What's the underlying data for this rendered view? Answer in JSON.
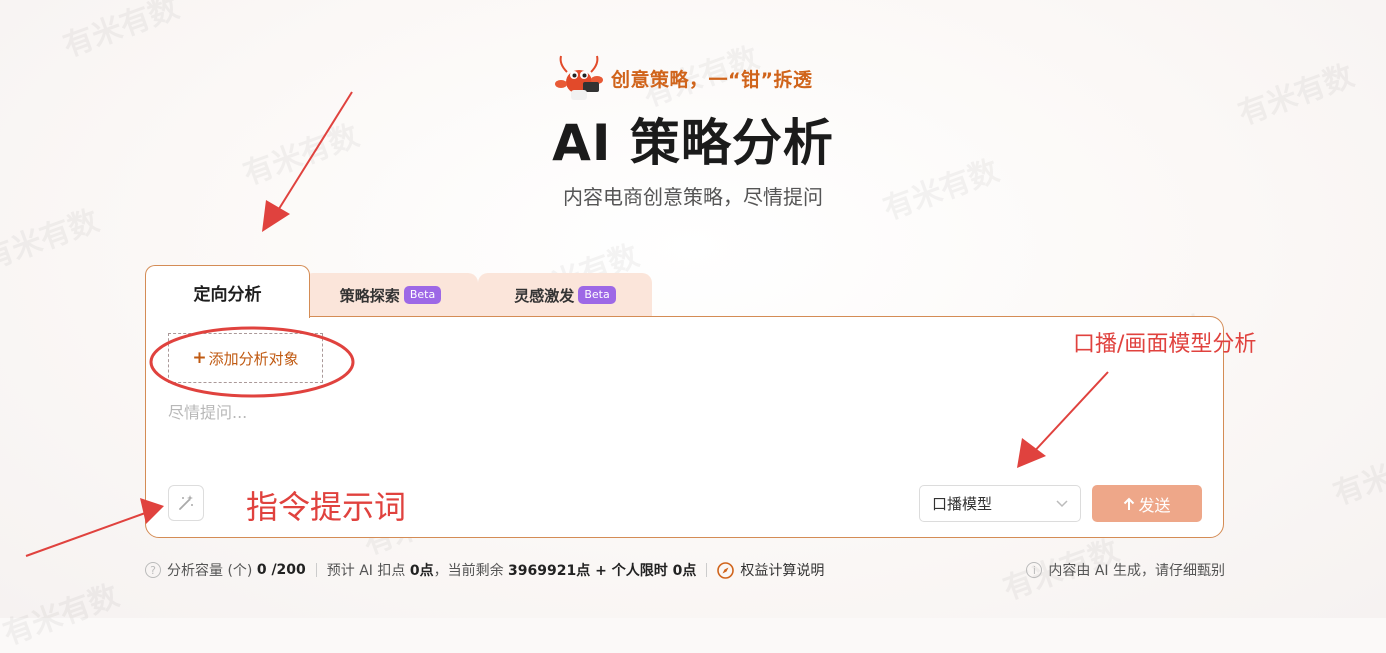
{
  "hero": {
    "tagline": "创意策略，一“钳”拆透",
    "title": "AI 策略分析",
    "subtitle": "内容电商创意策略，尽情提问"
  },
  "tabs": [
    {
      "label": "定向分析",
      "badge": ""
    },
    {
      "label": "策略探索",
      "badge": "Beta"
    },
    {
      "label": "灵感激发",
      "badge": "Beta"
    }
  ],
  "panel": {
    "add_target_label": "添加分析对象",
    "prompt_placeholder": "尽情提问...",
    "model_select_value": "口播模型",
    "send_label": "发送"
  },
  "footer": {
    "capacity_label": "分析容量 (个)",
    "capacity_value": "0 /200",
    "estimate_prefix": "预计 AI 扣点",
    "estimate_value": "0点",
    "remaining_prefix": "，当前剩余",
    "remaining_value": "3969921点 + 个人限时 0点",
    "rights_link": "权益计算说明",
    "disclaimer": "内容由 AI 生成，请仔细甄别"
  },
  "annotations": {
    "model_note": "口播/画面模型分析",
    "prompt_note": "指令提示词"
  },
  "watermark_text": "有米有数",
  "colors": {
    "accent": "#d0641b",
    "send_button": "#eea789",
    "beta_badge": "#9d68e6",
    "annotation_red": "#e0423e",
    "panel_border": "#d48c55"
  }
}
